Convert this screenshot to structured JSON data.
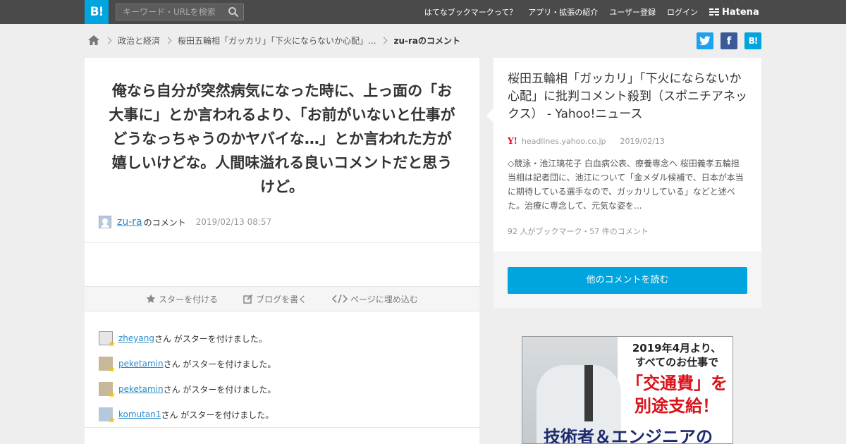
{
  "header": {
    "logo": "B!",
    "search_placeholder": "キーワード・URLを検索",
    "nav": [
      "はてなブックマークって？",
      "アプリ・拡張の紹介",
      "ユーザー登録",
      "ログイン"
    ],
    "brand": "Hatena"
  },
  "breadcrumb": {
    "items": [
      "政治と経済",
      "桜田五輪相「ガッカリ」「下火にならないか心配」..."
    ],
    "current": "zu-raのコメント"
  },
  "share": {
    "facebook": "f",
    "hatena": "B!"
  },
  "comment": {
    "text": "俺なら自分が突然病気になった時に、上っ面の「お大事に」とか言われるより、「お前がいないと仕事がどうなっちゃうのかヤバイな…」とか言われた方が嬉しいけどな。人間味溢れる良いコメントだと思うけど。",
    "author": "zu-ra",
    "author_suffix": "のコメント",
    "date": "2019/02/13 08:57"
  },
  "actions": [
    "スターを付ける",
    "ブログを書く",
    "ページに埋め込む"
  ],
  "stars": {
    "suffix": "さん がスターを付けました。",
    "users": [
      "zheyang",
      "peketamin",
      "peketamin",
      "komutan1"
    ]
  },
  "entry": {
    "title": "桜田五輪相「ガッカリ」「下火にならないか心配」に批判コメント殺到（スポニチアネックス） - Yahoo!ニュース",
    "source_logo": "Y!",
    "domain": "headlines.yahoo.co.jp",
    "date": "2019/02/13",
    "summary": "◇競泳・池江璃花子 白血病公表、療養専念へ 桜田義孝五輪担当相は記者団に、池江について「金メダル候補で、日本が本当に期待している選手なので、ガッカリしている」などと述べた。治療に専念して、元気な姿を...",
    "counts": "92 人がブックマーク・57 件のコメント",
    "read_button": "他のコメントを読む"
  },
  "ad": {
    "line1": "2019年4月より、",
    "line2": "すべてのお仕事で",
    "line3": "「交通費」を",
    "line4": "別途支給！",
    "line5": "技術者＆エンジニアの"
  }
}
